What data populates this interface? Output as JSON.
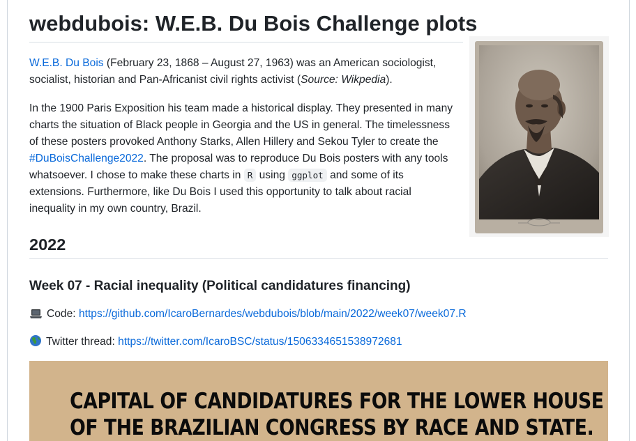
{
  "title": "webdubois: W.E.B. Du Bois Challenge plots",
  "intro": {
    "link_text": "W.E.B. Du Bois",
    "text_after_link": " (February 23, 1868 – August 27, 1963) was an American sociologist, socialist, historian and Pan-Africanist civil rights activist (",
    "source_label": "Source: Wikpedia",
    "text_end": ")."
  },
  "paragraph2": {
    "part1": "In the 1900 Paris Exposition his team made a historical display. They presented in many charts the situation of Black people in Georgia and the US in general. The timelessness of these posters provoked Anthony Starks, Allen Hillery and Sekou Tyler to create the ",
    "hashtag": "#DuBoisChallenge2022",
    "part2": ". The proposal was to reproduce Du Bois posters with any tools whatsoever. I chose to make these charts in ",
    "code_r": "R",
    "part3": " using ",
    "code_ggplot": "ggplot",
    "part4": " and some of its extensions. Furthermore, like Du Bois I used this opportunity to talk about racial inequality in my own country, Brazil."
  },
  "section_year": "2022",
  "week": {
    "title": "Week 07 - Racial inequality (Political candidatures financing)",
    "code_label": "Code:",
    "code_icon": "laptop-icon",
    "code_url": "https://github.com/IcaroBernardes/webdubois/blob/main/2022/week07/week07.R",
    "twitter_label": "Twitter thread:",
    "twitter_icon": "globe-icon",
    "twitter_url": "https://twitter.com/IcaroBSC/status/1506334651538972681"
  },
  "banner": {
    "line1": "CAPITAL OF CANDIDATURES FOR THE LOWER HOUSE",
    "line2": "OF THE BRAZILIAN CONGRESS BY RACE AND STATE."
  },
  "colors": {
    "link": "#0969da",
    "banner_bg": "#d2b48c"
  }
}
